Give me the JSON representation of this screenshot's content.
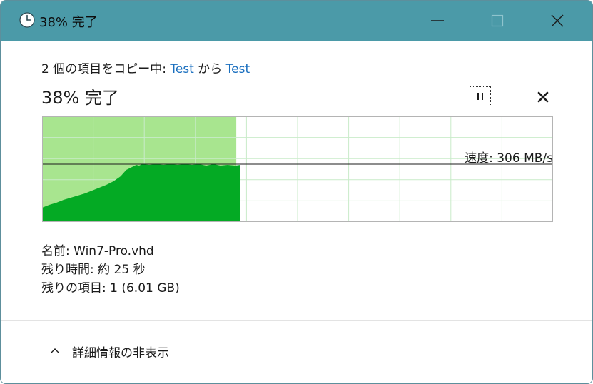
{
  "window": {
    "title": "38% 完了"
  },
  "titlebar_buttons": {
    "minimize": "minimize-icon",
    "maximize": "maximize-icon",
    "close": "close-icon"
  },
  "copy": {
    "prefix": "2 個の項目をコピー中: ",
    "source": "Test",
    "middle": " から ",
    "destination": "Test"
  },
  "progress": {
    "heading": "38% 完了",
    "percent": 38
  },
  "speed": {
    "label": "速度: 306 MB/s"
  },
  "details": {
    "name": "名前: Win7-Pro.vhd",
    "time_remaining": "残り時間: 約 25 秒",
    "items_remaining": "残りの項目: 1 (6.01 GB)"
  },
  "footer": {
    "toggle_label": "詳細情報の非表示"
  },
  "colors": {
    "titlebar": "#4b9aa8",
    "link": "#1a6fbf",
    "graph_fill": "#04aa24",
    "graph_progress": "#a8e58f",
    "graph_grid": "#c9ebc9"
  }
}
